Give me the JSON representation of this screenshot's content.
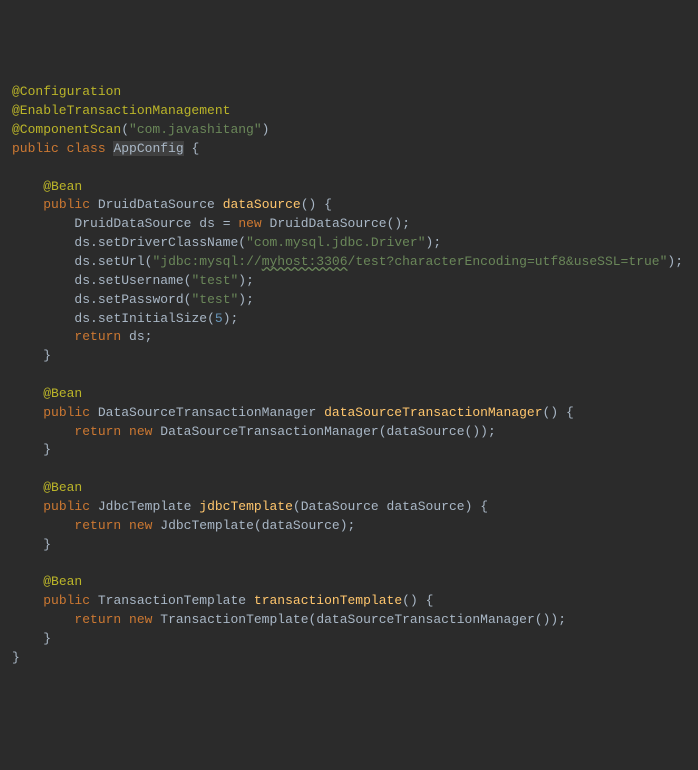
{
  "annotations": {
    "configuration": "@Configuration",
    "enableTx": "@EnableTransactionManagement",
    "componentScan": "@ComponentScan",
    "scanPkg": "\"com.javashitang\"",
    "bean": "@Bean"
  },
  "kw": {
    "public": "public",
    "class": "class",
    "new": "new",
    "return": "return"
  },
  "cls": {
    "AppConfig": "AppConfig",
    "DruidDataSource": "DruidDataSource",
    "DataSourceTransactionManager": "DataSourceTransactionManager",
    "JdbcTemplate": "JdbcTemplate",
    "TransactionTemplate": "TransactionTemplate",
    "DataSource": "DataSource"
  },
  "methods": {
    "dataSource": "dataSource",
    "dataSourceTransactionManager": "dataSourceTransactionManager",
    "jdbcTemplate": "jdbcTemplate",
    "transactionTemplate": "transactionTemplate"
  },
  "locals": {
    "ds": "ds",
    "dataSource": "dataSource"
  },
  "calls": {
    "setDriverClassName": "setDriverClassName",
    "setUrl": "setUrl",
    "setUsername": "setUsername",
    "setPassword": "setPassword",
    "setInitialSize": "setInitialSize"
  },
  "strings": {
    "driver": "\"com.mysql.jdbc.Driver\"",
    "urlPrefix": "\"jdbc:mysql://",
    "urlHost": "myhost:3306",
    "urlSuffix": "/test?characterEncoding=utf8&useSSL=true\"",
    "test": "\"test\""
  },
  "nums": {
    "five": "5"
  },
  "punct": {
    "lparen": "(",
    "rparen": ")",
    "lbrace": "{",
    "rbrace": "}",
    "semi": ";",
    "eq": "="
  }
}
